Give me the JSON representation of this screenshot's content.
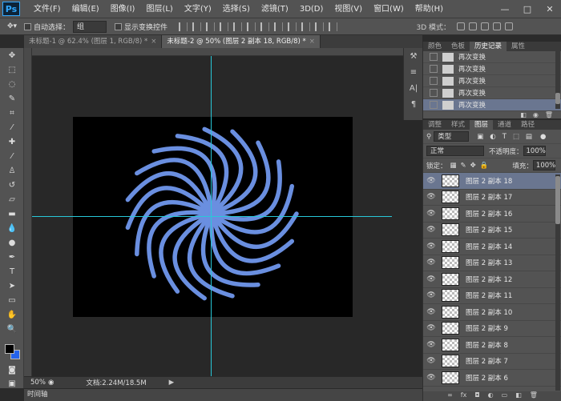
{
  "app": {
    "logo": "Ps"
  },
  "menu": [
    "文件(F)",
    "编辑(E)",
    "图像(I)",
    "图层(L)",
    "文字(Y)",
    "选择(S)",
    "滤镜(T)",
    "3D(D)",
    "视图(V)",
    "窗口(W)",
    "帮助(H)"
  ],
  "window_controls": {
    "minimize": "—",
    "maximize": "□",
    "close": "✕"
  },
  "options": {
    "auto_select_label": "自动选择：",
    "auto_select_value": "组",
    "show_transform_label": "显示变换控件",
    "mode_3d_label": "3D 模式："
  },
  "tabs": [
    {
      "label": "未标题-1 @ 62.4% (图层 1, RGB/8) *",
      "active": false
    },
    {
      "label": "未标题-2 @ 50% (图层 2 副本 18, RGB/8) *",
      "active": true
    }
  ],
  "status": {
    "zoom": "50%",
    "doc_info": "文档:2.24M/18.5M",
    "timeline": "时间轴"
  },
  "history_panel": {
    "tabs": [
      "颜色",
      "色板",
      "历史记录",
      "属性"
    ],
    "active_tab": "历史记录",
    "items": [
      "再次变换",
      "再次变换",
      "再次变换",
      "再次变换",
      "再次变换"
    ],
    "active_index": 4
  },
  "layers_panel": {
    "tabs": [
      "调整",
      "样式",
      "图层",
      "通道",
      "路径"
    ],
    "active_tab": "图层",
    "filter_kind": "类型",
    "blend_mode": "正常",
    "opacity_label": "不透明度：",
    "opacity": "100%",
    "lock_label": "锁定：",
    "fill_label": "填充：",
    "fill": "100%",
    "layers": [
      "图层 2 副本 18",
      "图层 2 副本 17",
      "图层 2 副本 16",
      "图层 2 副本 15",
      "图层 2 副本 14",
      "图层 2 副本 13",
      "图层 2 副本 12",
      "图层 2 副本 11",
      "图层 2 副本 10",
      "图层 2 副本 9",
      "图层 2 副本 8",
      "图层 2 副本 7",
      "图层 2 副本 6"
    ],
    "active_index": 0
  },
  "colors": {
    "rosette": "#6a8fe0",
    "canvas": "#000000",
    "guide": "#28c8d8",
    "foreground": "#000000",
    "background": "#2563eb"
  },
  "rosette": {
    "petal_count": 19
  }
}
